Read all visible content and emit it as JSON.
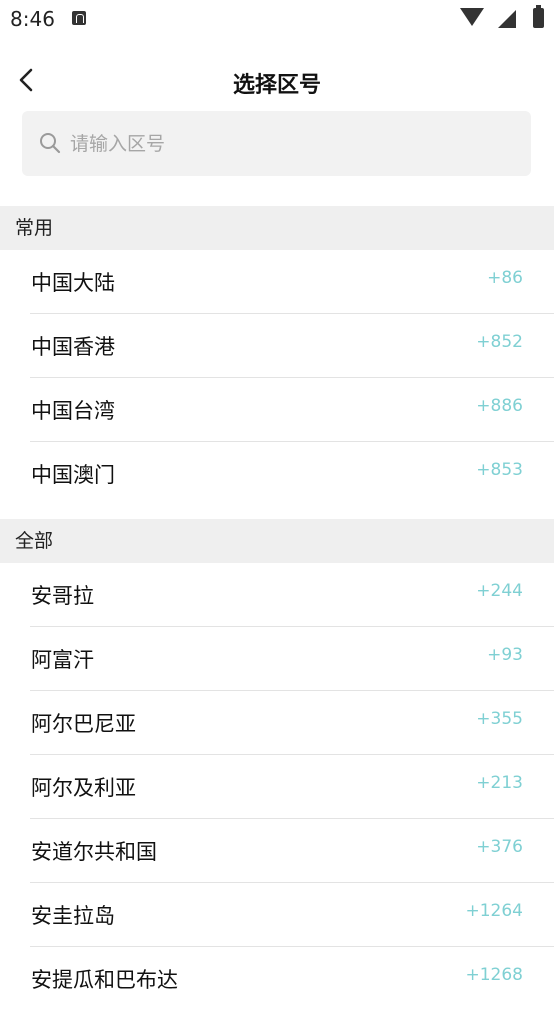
{
  "status_bar": {
    "time": "8:46"
  },
  "header": {
    "title": "选择区号"
  },
  "search": {
    "placeholder": "请输入区号"
  },
  "sections": [
    {
      "title": "常用",
      "items": [
        {
          "name": "中国大陆",
          "code": "+86"
        },
        {
          "name": "中国香港",
          "code": "+852"
        },
        {
          "name": "中国台湾",
          "code": "+886"
        },
        {
          "name": "中国澳门",
          "code": "+853"
        }
      ]
    },
    {
      "title": "全部",
      "items": [
        {
          "name": "安哥拉",
          "code": "+244"
        },
        {
          "name": "阿富汗",
          "code": "+93"
        },
        {
          "name": "阿尔巴尼亚",
          "code": "+355"
        },
        {
          "name": "阿尔及利亚",
          "code": "+213"
        },
        {
          "name": "安道尔共和国",
          "code": "+376"
        },
        {
          "name": "安圭拉岛",
          "code": "+1264"
        },
        {
          "name": "安提瓜和巴布达",
          "code": "+1268"
        }
      ]
    }
  ]
}
